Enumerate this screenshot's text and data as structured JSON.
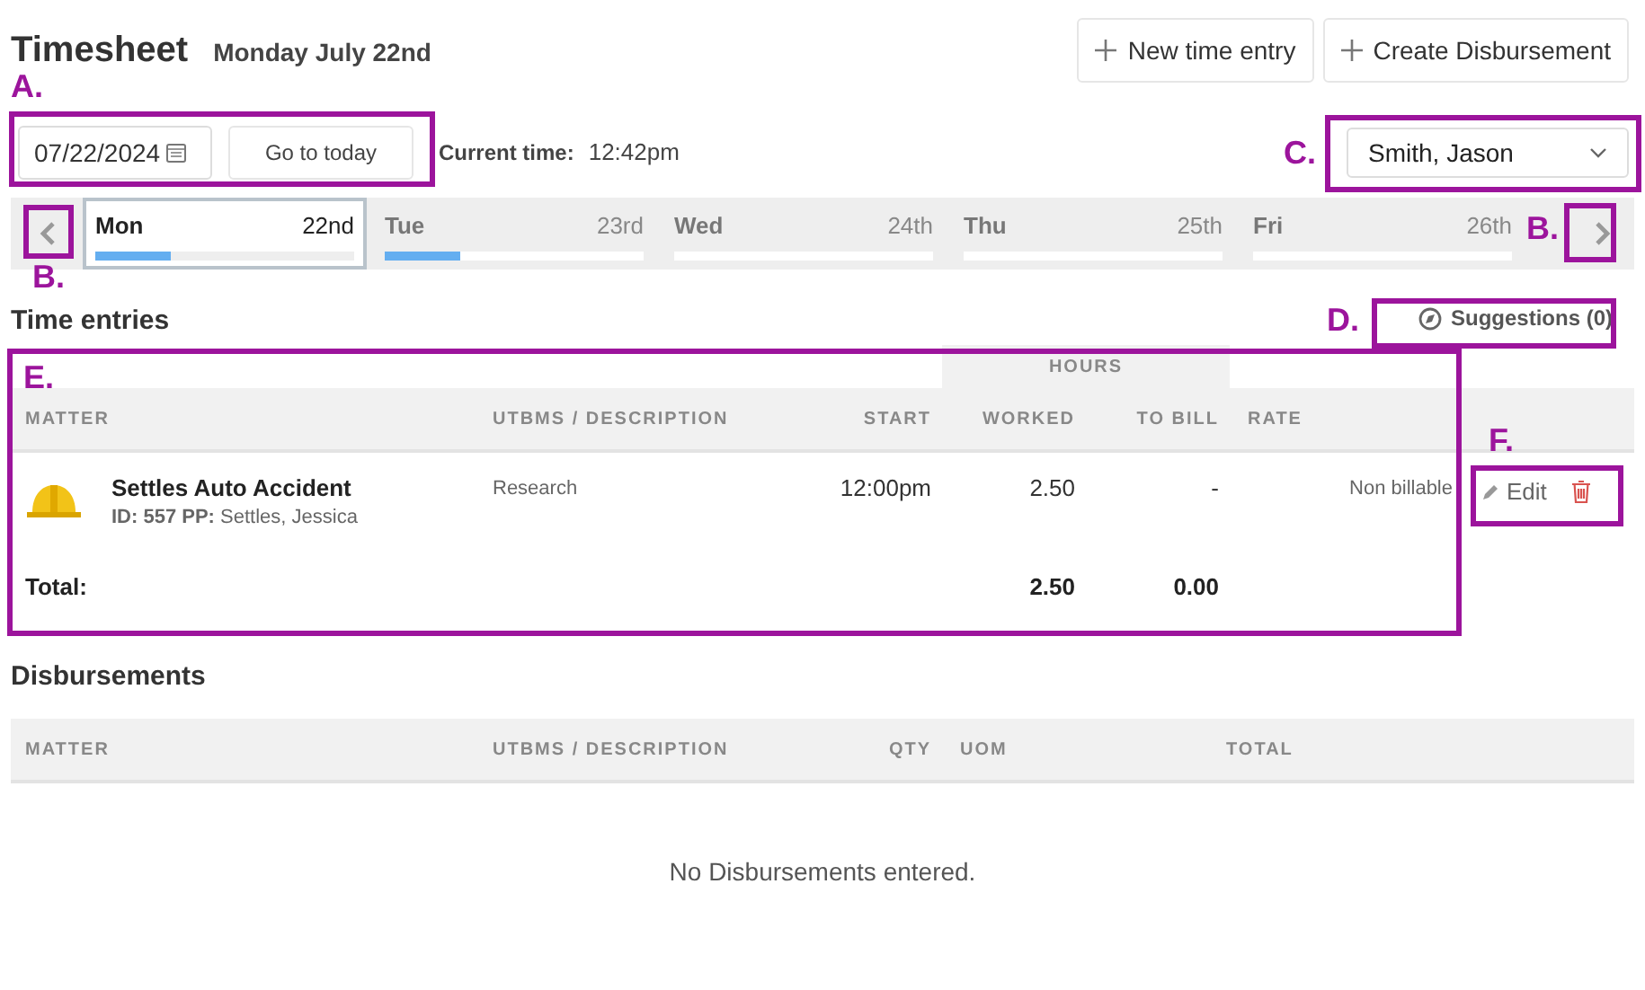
{
  "header": {
    "title": "Timesheet",
    "date": "Monday July 22nd"
  },
  "buttons": [
    "New time entry",
    "Create Disbursement"
  ],
  "date_field": {
    "value": "07/22/2024"
  },
  "today_button": "Go to today",
  "current_time": {
    "label": "Current time:",
    "value": "12:42pm"
  },
  "user_select": {
    "value": "Smith, Jason"
  },
  "days": [
    {
      "name": "Mon",
      "date": "22nd",
      "selected": true,
      "level": 0.29
    },
    {
      "name": "Tue",
      "date": "23rd",
      "selected": false,
      "level": 0.29
    },
    {
      "name": "Wed",
      "date": "24th",
      "selected": false
    },
    {
      "name": "Thu",
      "date": "25th",
      "selected": false
    },
    {
      "name": "Fri",
      "date": "26th",
      "selected": false
    }
  ],
  "time_entries": {
    "title": "Time entries",
    "suggestions": "Suggestions (0)",
    "group_header": "HOURS",
    "columns": [
      "MATTER",
      "UTBMS / DESCRIPTION",
      "START",
      "WORKED",
      "TO BILL",
      "RATE"
    ],
    "rows": [
      {
        "matter": "Settles Auto Accident",
        "details": "**ID: 557 PP:** Settles, Jessica",
        "description": "Research",
        "start": "12:00pm",
        "worked": "2.50",
        "to_bill": "-",
        "rate": "Non billable",
        "edit": "Edit"
      }
    ],
    "total": {
      "label": "Total:",
      "worked": "2.50",
      "to_bill": "0.00"
    }
  },
  "disbursements": {
    "title": "Disbursements",
    "columns": [
      "MATTER",
      "UTBMS / DESCRIPTION",
      "QTY",
      "UOM",
      "TOTAL"
    ],
    "empty": "No Disbursements entered."
  },
  "annotations": [
    "A.",
    "B.",
    "B.",
    "C.",
    "D.",
    "E.",
    "F."
  ]
}
